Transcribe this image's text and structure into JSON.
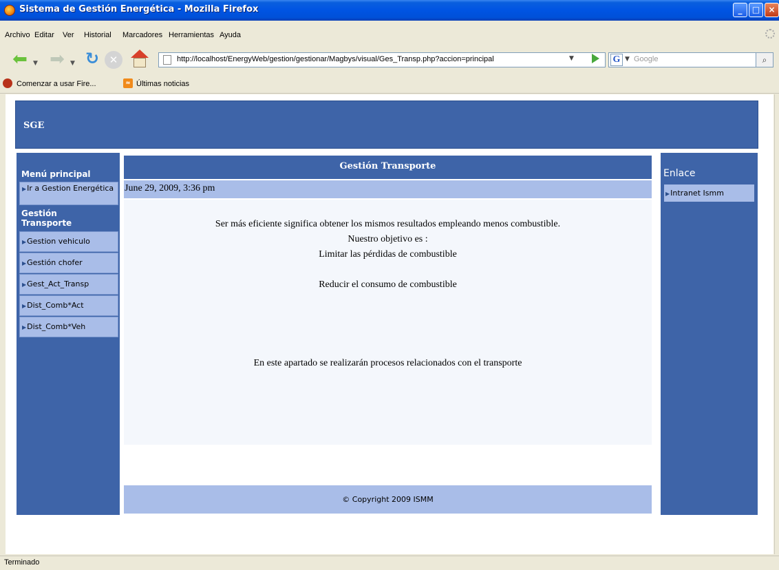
{
  "window": {
    "title": "Sistema de Gestión Energética - Mozilla Firefox"
  },
  "menubar": {
    "items": [
      "Archivo",
      "Editar",
      "Ver",
      "Historial",
      "Marcadores",
      "Herramientas",
      "Ayuda"
    ]
  },
  "navbar": {
    "url": "http://localhost/EnergyWeb/gestion/gestionar/Magbys/visual/Ges_Transp.php?accion=principal",
    "search_engine_letter": "G",
    "search_placeholder": "Google"
  },
  "bookmarks": {
    "items": [
      "Comenzar a usar Fire...",
      "Últimas noticias"
    ]
  },
  "page": {
    "header_title": "SGE",
    "left_menu": {
      "heading": "Menú principal",
      "items": [
        "Ir a Gestion Energética"
      ],
      "section_heading": "Gestión Transporte",
      "section_items": [
        "Gestion vehiculo",
        "Gestión chofer",
        "Gest_Act_Transp",
        "Dist_Comb*Act",
        "Dist_Comb*Veh"
      ]
    },
    "main": {
      "title": "Gestión Transporte",
      "date": "June 29, 2009, 3:36 pm",
      "line1": "Ser más eficiente significa obtener los mismos resultados empleando menos combustible.",
      "line2": "Nuestro objetivo es :",
      "line3": "Limitar las pérdidas de combustible",
      "line4": "Reducir el consumo de combustible",
      "line5": "En este apartado se realizarán procesos relacionados con el transporte",
      "footer": "© Copyright 2009 ISMM"
    },
    "right_menu": {
      "heading": "Enlace",
      "items": [
        "Intranet Ismm"
      ]
    }
  },
  "statusbar": {
    "text": "Terminado"
  }
}
